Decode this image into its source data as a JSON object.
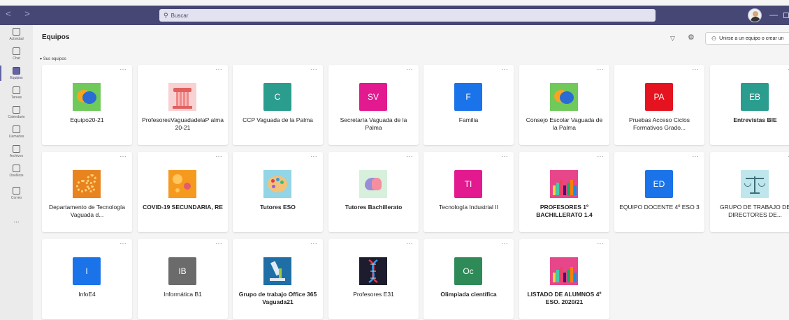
{
  "titlebar": {
    "search_placeholder": "Buscar",
    "nav_arrows": "< >"
  },
  "rail": {
    "items": [
      {
        "label": "Actividad",
        "icon": "bell-icon"
      },
      {
        "label": "Chat",
        "icon": "chat-icon"
      },
      {
        "label": "Equipos",
        "icon": "teams-icon",
        "active": true
      },
      {
        "label": "Tareas",
        "icon": "assignments-icon"
      },
      {
        "label": "Calendario",
        "icon": "calendar-icon"
      },
      {
        "label": "Llamadas",
        "icon": "phone-icon"
      },
      {
        "label": "Archivos",
        "icon": "files-icon"
      },
      {
        "label": "OneNote",
        "icon": "onenote-icon"
      },
      {
        "label": "Correo",
        "icon": "mail-icon"
      }
    ],
    "more": "..."
  },
  "main": {
    "title": "Equipos",
    "join_button": "Unirse a un equipo o crear un",
    "section_label": "Sus equipos",
    "more_label": "···"
  },
  "teams": [
    {
      "name": "Equipo20-21",
      "tile": "bubbles",
      "initials": "",
      "color": "#6fca5b",
      "bold": false
    },
    {
      "name": "ProfesoresVaguadadelaP alma 20-21",
      "tile": "column",
      "initials": "",
      "color": "#f8d2d2",
      "bold": false
    },
    {
      "name": "CCP Vaguada de la Palma",
      "tile": "initials",
      "initials": "C",
      "color": "#2a9d8f",
      "bold": false
    },
    {
      "name": "Secretaría Vaguada de la Palma",
      "tile": "initials",
      "initials": "SV",
      "color": "#e3198f",
      "bold": false
    },
    {
      "name": "Familia",
      "tile": "initials",
      "initials": "F",
      "color": "#1a73e8",
      "bold": false
    },
    {
      "name": "Consejo Escolar Vaguada de la Palma",
      "tile": "bubbles",
      "initials": "",
      "color": "#6fca5b",
      "bold": false
    },
    {
      "name": "Pruebas Acceso Ciclos Formativos Grado...",
      "tile": "initials",
      "initials": "PA",
      "color": "#e5131f",
      "bold": false
    },
    {
      "name": "Entrevistas BIE",
      "tile": "initials",
      "initials": "EB",
      "color": "#2a9d8f",
      "bold": true
    },
    {
      "name": "Departamento de Tecnología Vaguada d...",
      "tile": "gears",
      "initials": "",
      "color": "#e8831e",
      "bold": false
    },
    {
      "name": "COVID-19 SECUNDARIA, RE",
      "tile": "virus",
      "initials": "",
      "color": "#f59a1e",
      "bold": true
    },
    {
      "name": "Tutores ESO",
      "tile": "palette",
      "initials": "",
      "color": "#92d5e6",
      "bold": true
    },
    {
      "name": "Tutores Bachillerato",
      "tile": "brain",
      "initials": "",
      "color": "#d6f0dc",
      "bold": true
    },
    {
      "name": "Tecnología Industrial II",
      "tile": "initials",
      "initials": "TI",
      "color": "#e3198f",
      "bold": false
    },
    {
      "name": "PROFESORES 1º BACHILLERATO 1.4",
      "tile": "pencils",
      "initials": "",
      "color": "#e8468a",
      "bold": true
    },
    {
      "name": "EQUIPO DOCENTE 4º ESO 3",
      "tile": "initials",
      "initials": "ED",
      "color": "#1a73e8",
      "bold": false
    },
    {
      "name": "GRUPO DE TRABAJO DE DIRECTORES DE...",
      "tile": "scale",
      "initials": "",
      "color": "#bfe6ec",
      "bold": false
    },
    {
      "name": "InfoE4",
      "tile": "initials",
      "initials": "I",
      "color": "#1a73e8",
      "bold": false
    },
    {
      "name": "Informática B1",
      "tile": "initials",
      "initials": "IB",
      "color": "#6b6b6b",
      "bold": false
    },
    {
      "name": "Grupo de trabajo Office 365 Vaguada21",
      "tile": "scope",
      "initials": "",
      "color": "#1f6fa6",
      "bold": true
    },
    {
      "name": "Profesores E31",
      "tile": "dna",
      "initials": "",
      "color": "#1c1c2e",
      "bold": false
    },
    {
      "name": "Olimpiada científica",
      "tile": "initials",
      "initials": "Oc",
      "color": "#2e8b57",
      "bold": true
    },
    {
      "name": "LISTADO DE ALUMNOS 4º ESO. 2020/21",
      "tile": "pencils",
      "initials": "",
      "color": "#e8468a",
      "bold": true
    }
  ]
}
